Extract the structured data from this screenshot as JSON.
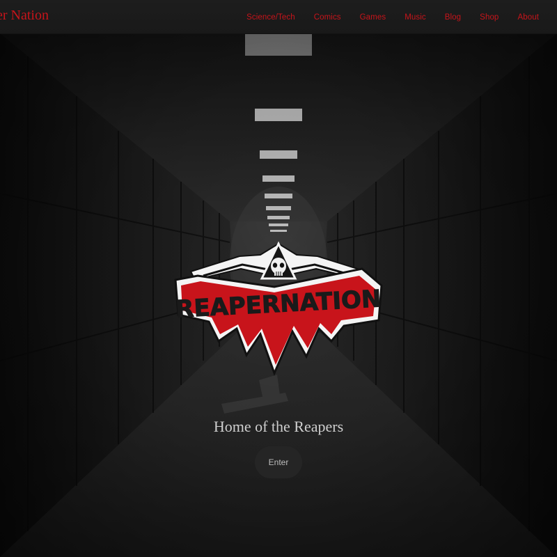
{
  "navbar": {
    "brand": "er Nation",
    "links": [
      {
        "label": "Science/Tech"
      },
      {
        "label": "Comics"
      },
      {
        "label": "Games"
      },
      {
        "label": "Music"
      },
      {
        "label": "Blog"
      },
      {
        "label": "Shop"
      },
      {
        "label": "About"
      }
    ]
  },
  "hero": {
    "tagline": "Home of the Reapers",
    "enter_label": "Enter"
  },
  "logo": {
    "text": "REAPERNATION"
  },
  "colors": {
    "accent": "#c8141b",
    "nav_bg": "#1b1b1b",
    "text_light": "#cfcfcf"
  }
}
